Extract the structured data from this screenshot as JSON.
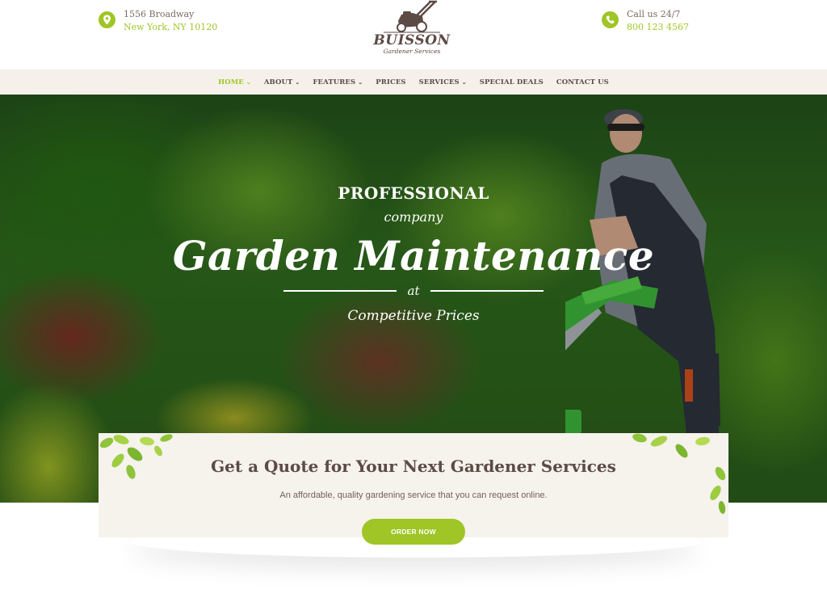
{
  "header": {
    "address": {
      "icon": "map-pin-icon",
      "line1": "1556 Broadway",
      "line2": "New York, NY 10120"
    },
    "phone": {
      "icon": "phone-icon",
      "line1": "Call us 24/7",
      "line2": "800 123 4567"
    },
    "logo": {
      "name": "BUISSON",
      "tagline": "Gardener Services",
      "icon": "lawn-mower-icon"
    }
  },
  "nav": {
    "items": [
      {
        "label": "HOME",
        "dropdown": true,
        "active": true
      },
      {
        "label": "ABOUT",
        "dropdown": true,
        "active": false
      },
      {
        "label": "FEATURES",
        "dropdown": true,
        "active": false
      },
      {
        "label": "PRICES",
        "dropdown": false,
        "active": false
      },
      {
        "label": "SERVICES",
        "dropdown": true,
        "active": false
      },
      {
        "label": "SPECIAL DEALS",
        "dropdown": false,
        "active": false
      },
      {
        "label": "CONTACT US",
        "dropdown": false,
        "active": false
      }
    ],
    "chevron": "⌄"
  },
  "hero": {
    "kicker": "PROFESSIONAL",
    "subkicker": "company",
    "title": "Garden Maintenance",
    "connector": "at",
    "tagline": "Competitive Prices"
  },
  "quote": {
    "title": "Get a Quote for Your Next Gardener Services",
    "subtitle": "An affordable, quality gardening service that you can request online.",
    "button": "ORDER NOW"
  },
  "colors": {
    "accent": "#9fc526",
    "text_brown": "#5c4a45",
    "nav_bg": "#f5f1ea",
    "quote_bg": "#f6f2ec"
  }
}
